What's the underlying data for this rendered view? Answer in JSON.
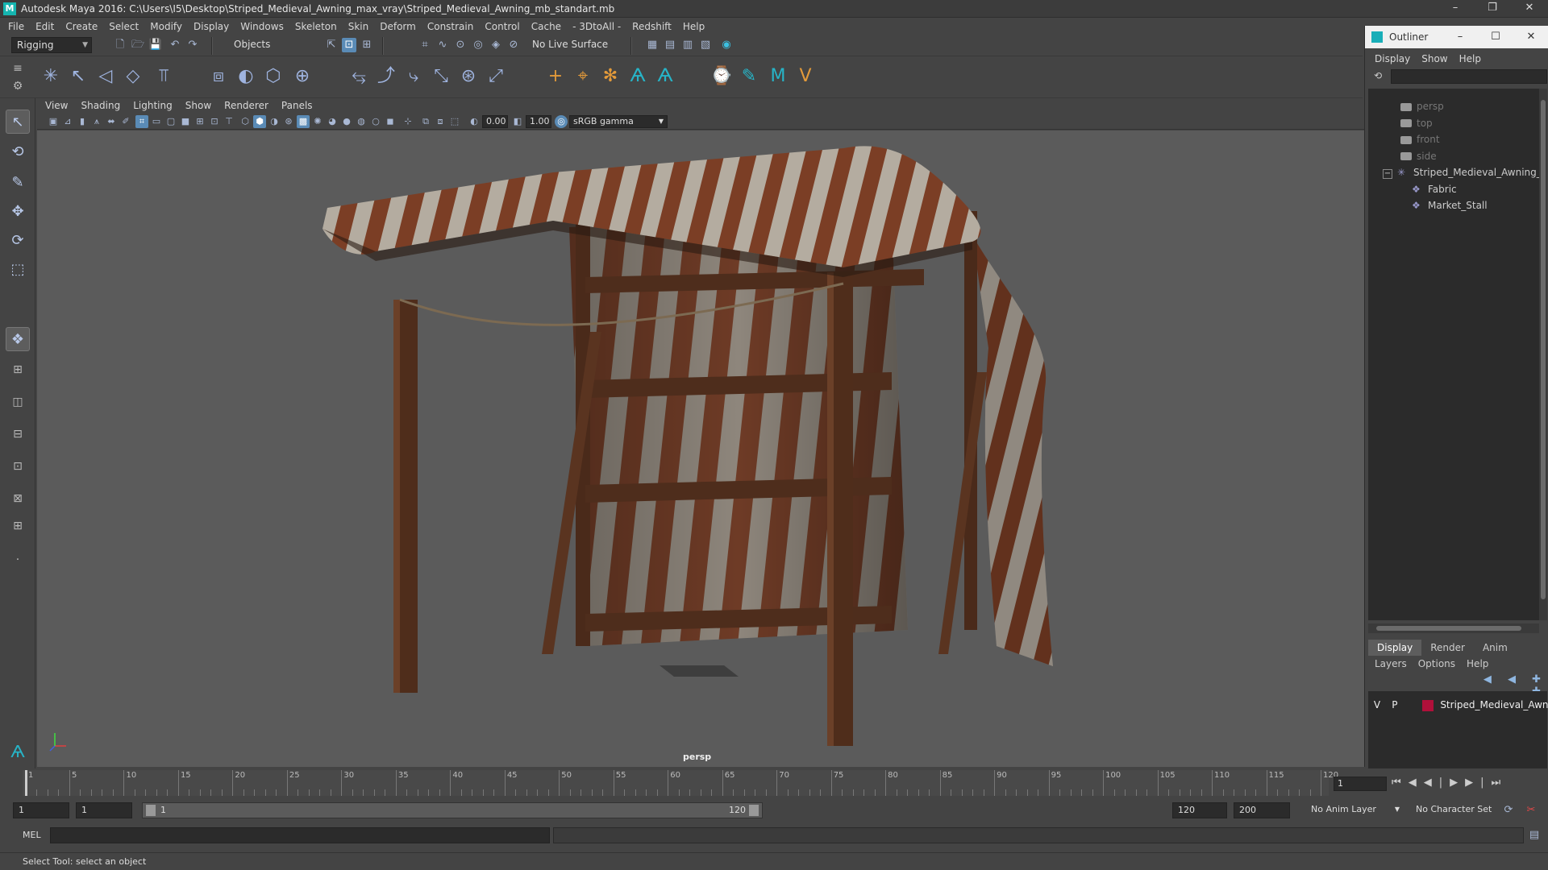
{
  "window": {
    "title": "Autodesk Maya 2016: C:\\Users\\I5\\Desktop\\Striped_Medieval_Awning_max_vray\\Striped_Medieval_Awning_mb_standart.mb",
    "logo_text": "M",
    "min": "–",
    "restore": "❐",
    "close": "✕"
  },
  "menubar": [
    "File",
    "Edit",
    "Create",
    "Select",
    "Modify",
    "Display",
    "Windows",
    "Skeleton",
    "Skin",
    "Deform",
    "Constrain",
    "Control",
    "Cache",
    "- 3DtoAll -",
    "Redshift",
    "Help"
  ],
  "statusline": {
    "menuset": "Rigging",
    "selmode": "Objects",
    "live_surface": "No Live Surface"
  },
  "viewport": {
    "menu": [
      "View",
      "Shading",
      "Lighting",
      "Show",
      "Renderer",
      "Panels"
    ],
    "exposure": "0.00",
    "gamma": "1.00",
    "colorspace": "sRGB gamma",
    "camera_label": "persp",
    "axis_labels": {
      "x": "x",
      "y": "y",
      "z": "z"
    }
  },
  "outliner": {
    "title": "Outliner",
    "menu": [
      "Display",
      "Show",
      "Help"
    ],
    "items": [
      {
        "label": "persp",
        "dim": true,
        "kind": "camera"
      },
      {
        "label": "top",
        "dim": true,
        "kind": "camera"
      },
      {
        "label": "front",
        "dim": true,
        "kind": "camera"
      },
      {
        "label": "side",
        "dim": true,
        "kind": "camera"
      },
      {
        "label": "Striped_Medieval_Awning_n",
        "dim": false,
        "kind": "group"
      },
      {
        "label": "Fabric",
        "dim": false,
        "kind": "mesh"
      },
      {
        "label": "Market_Stall",
        "dim": false,
        "kind": "mesh"
      }
    ]
  },
  "layers": {
    "tabs": [
      "Display",
      "Render",
      "Anim"
    ],
    "active_tab": "Display",
    "menu": [
      "Layers",
      "Options",
      "Help"
    ],
    "row": {
      "v": "V",
      "p": "P",
      "name": "Striped_Medieval_Awn",
      "color": "#b0103a"
    }
  },
  "timeline": {
    "ticks": [
      1,
      5,
      10,
      15,
      20,
      25,
      30,
      35,
      40,
      45,
      50,
      55,
      60,
      65,
      70,
      75,
      80,
      85,
      90,
      95,
      100,
      105,
      110,
      115,
      120
    ],
    "current_frame": "1",
    "min": 1,
    "max": 120
  },
  "range": {
    "start": "1",
    "playback_start": "1",
    "bar_start": "1",
    "bar_end": "120",
    "playback_end": "120",
    "end": "200",
    "anim_layer": "No Anim Layer",
    "char_set": "No Character Set"
  },
  "cmdline": {
    "label": "MEL"
  },
  "helpline": {
    "text": "Select Tool: select an object"
  },
  "icons": {
    "play_controls": "⏮◀◀|▶▶|⏭"
  }
}
